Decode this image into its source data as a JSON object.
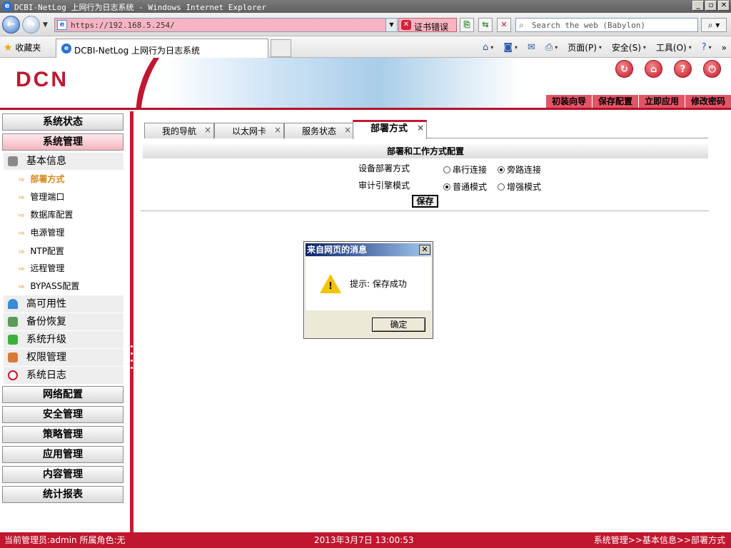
{
  "window": {
    "title": "DCBI-NetLog 上网行为日志系统 - Windows Internet Explorer",
    "buttons": [
      "_",
      "▫",
      "✕"
    ]
  },
  "address": {
    "url": "https://192.168.5.254/",
    "cert_error": "证书错误",
    "search_placeholder": "Search the web (Babylon)"
  },
  "favorites": {
    "label": "收藏夹",
    "tab_title": "DCBI-NetLog 上网行为日志系统"
  },
  "command_bar": {
    "page": "页面(P)",
    "safety": "安全(S)",
    "tools": "工具(O)"
  },
  "header": {
    "logo": "DCN",
    "quick_links": [
      "初装向导",
      "保存配置",
      "立即应用",
      "修改密码"
    ]
  },
  "sidebar": {
    "menus_top": [
      "系统状态",
      "系统管理"
    ],
    "basic_info": "基本信息",
    "leaves": [
      "部署方式",
      "管理端口",
      "数据库配置",
      "电源管理",
      "NTP配置",
      "远程管理",
      "BYPASS配置"
    ],
    "sub_items": [
      "高可用性",
      "备份恢复",
      "系统升级",
      "权限管理",
      "系统日志"
    ],
    "menus_bottom": [
      "网络配置",
      "安全管理",
      "策略管理",
      "应用管理",
      "内容管理",
      "统计报表"
    ]
  },
  "tabs": [
    "我的导航",
    "以太网卡",
    "服务状态",
    "部署方式"
  ],
  "panel": {
    "title": "部署和工作方式配置",
    "rows": [
      {
        "label": "设备部署方式",
        "options": [
          "串行连接",
          "旁路连接"
        ],
        "selected": 1
      },
      {
        "label": "审计引擎模式",
        "options": [
          "普通模式",
          "增强模式"
        ],
        "selected": 0
      }
    ],
    "save_label": "保存"
  },
  "dialog": {
    "title": "来自网页的消息",
    "message": "提示: 保存成功",
    "ok": "确定"
  },
  "status": {
    "admin": "当前管理员:admin  所属角色:无",
    "datetime": "2013年3月7日 13:00:53",
    "breadcrumb": "系统管理>>基本信息>>部署方式"
  }
}
